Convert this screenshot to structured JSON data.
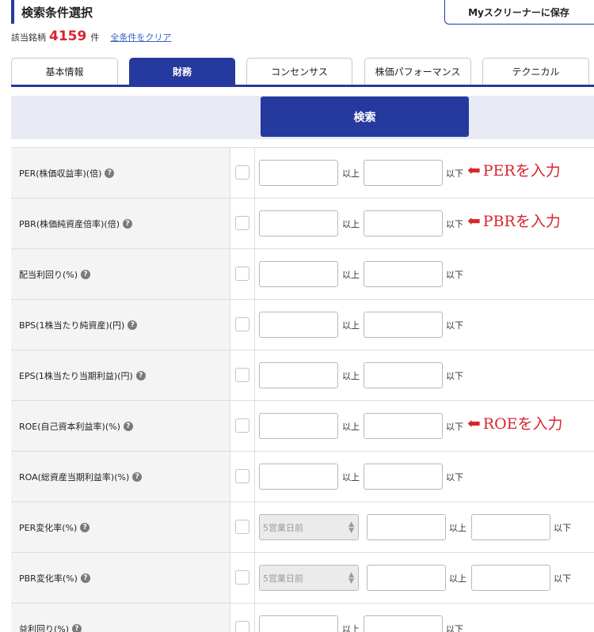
{
  "header": {
    "title": "検索条件選択",
    "save_label": "Myスクリーナーに保存"
  },
  "summary": {
    "prefix": "該当銘柄",
    "count": "4159",
    "unit": "件",
    "clear_label": "全条件をクリア"
  },
  "tabs": [
    {
      "label": "基本情報",
      "active": false
    },
    {
      "label": "財務",
      "active": true
    },
    {
      "label": "コンセンサス",
      "active": false
    },
    {
      "label": "株価パフォーマンス",
      "active": false
    },
    {
      "label": "テクニカル",
      "active": false
    }
  ],
  "search": {
    "label": "検索"
  },
  "labels": {
    "min": "以上",
    "max": "以下",
    "help": "?"
  },
  "rows": [
    {
      "label": "PER(株価収益率)(倍)",
      "note": "PERを入力"
    },
    {
      "label": "PBR(株価純資産倍率)(倍)",
      "note": "PBRを入力"
    },
    {
      "label": "配当利回り(%)"
    },
    {
      "label": "BPS(1株当たり純資産)(円)"
    },
    {
      "label": "EPS(1株当たり当期利益)(円)"
    },
    {
      "label": "ROE(自己資本利益率)(%)",
      "note": "ROEを入力"
    },
    {
      "label": "ROA(総資産当期利益率)(%)"
    },
    {
      "label": "PER変化率(%)",
      "select": "5営業日前"
    },
    {
      "label": "PBR変化率(%)",
      "select": "5営業日前"
    },
    {
      "label": "益利回り(%)"
    }
  ],
  "colors": {
    "brand": "#26399e",
    "accent_red": "#d8262e",
    "link": "#3a63c9"
  }
}
